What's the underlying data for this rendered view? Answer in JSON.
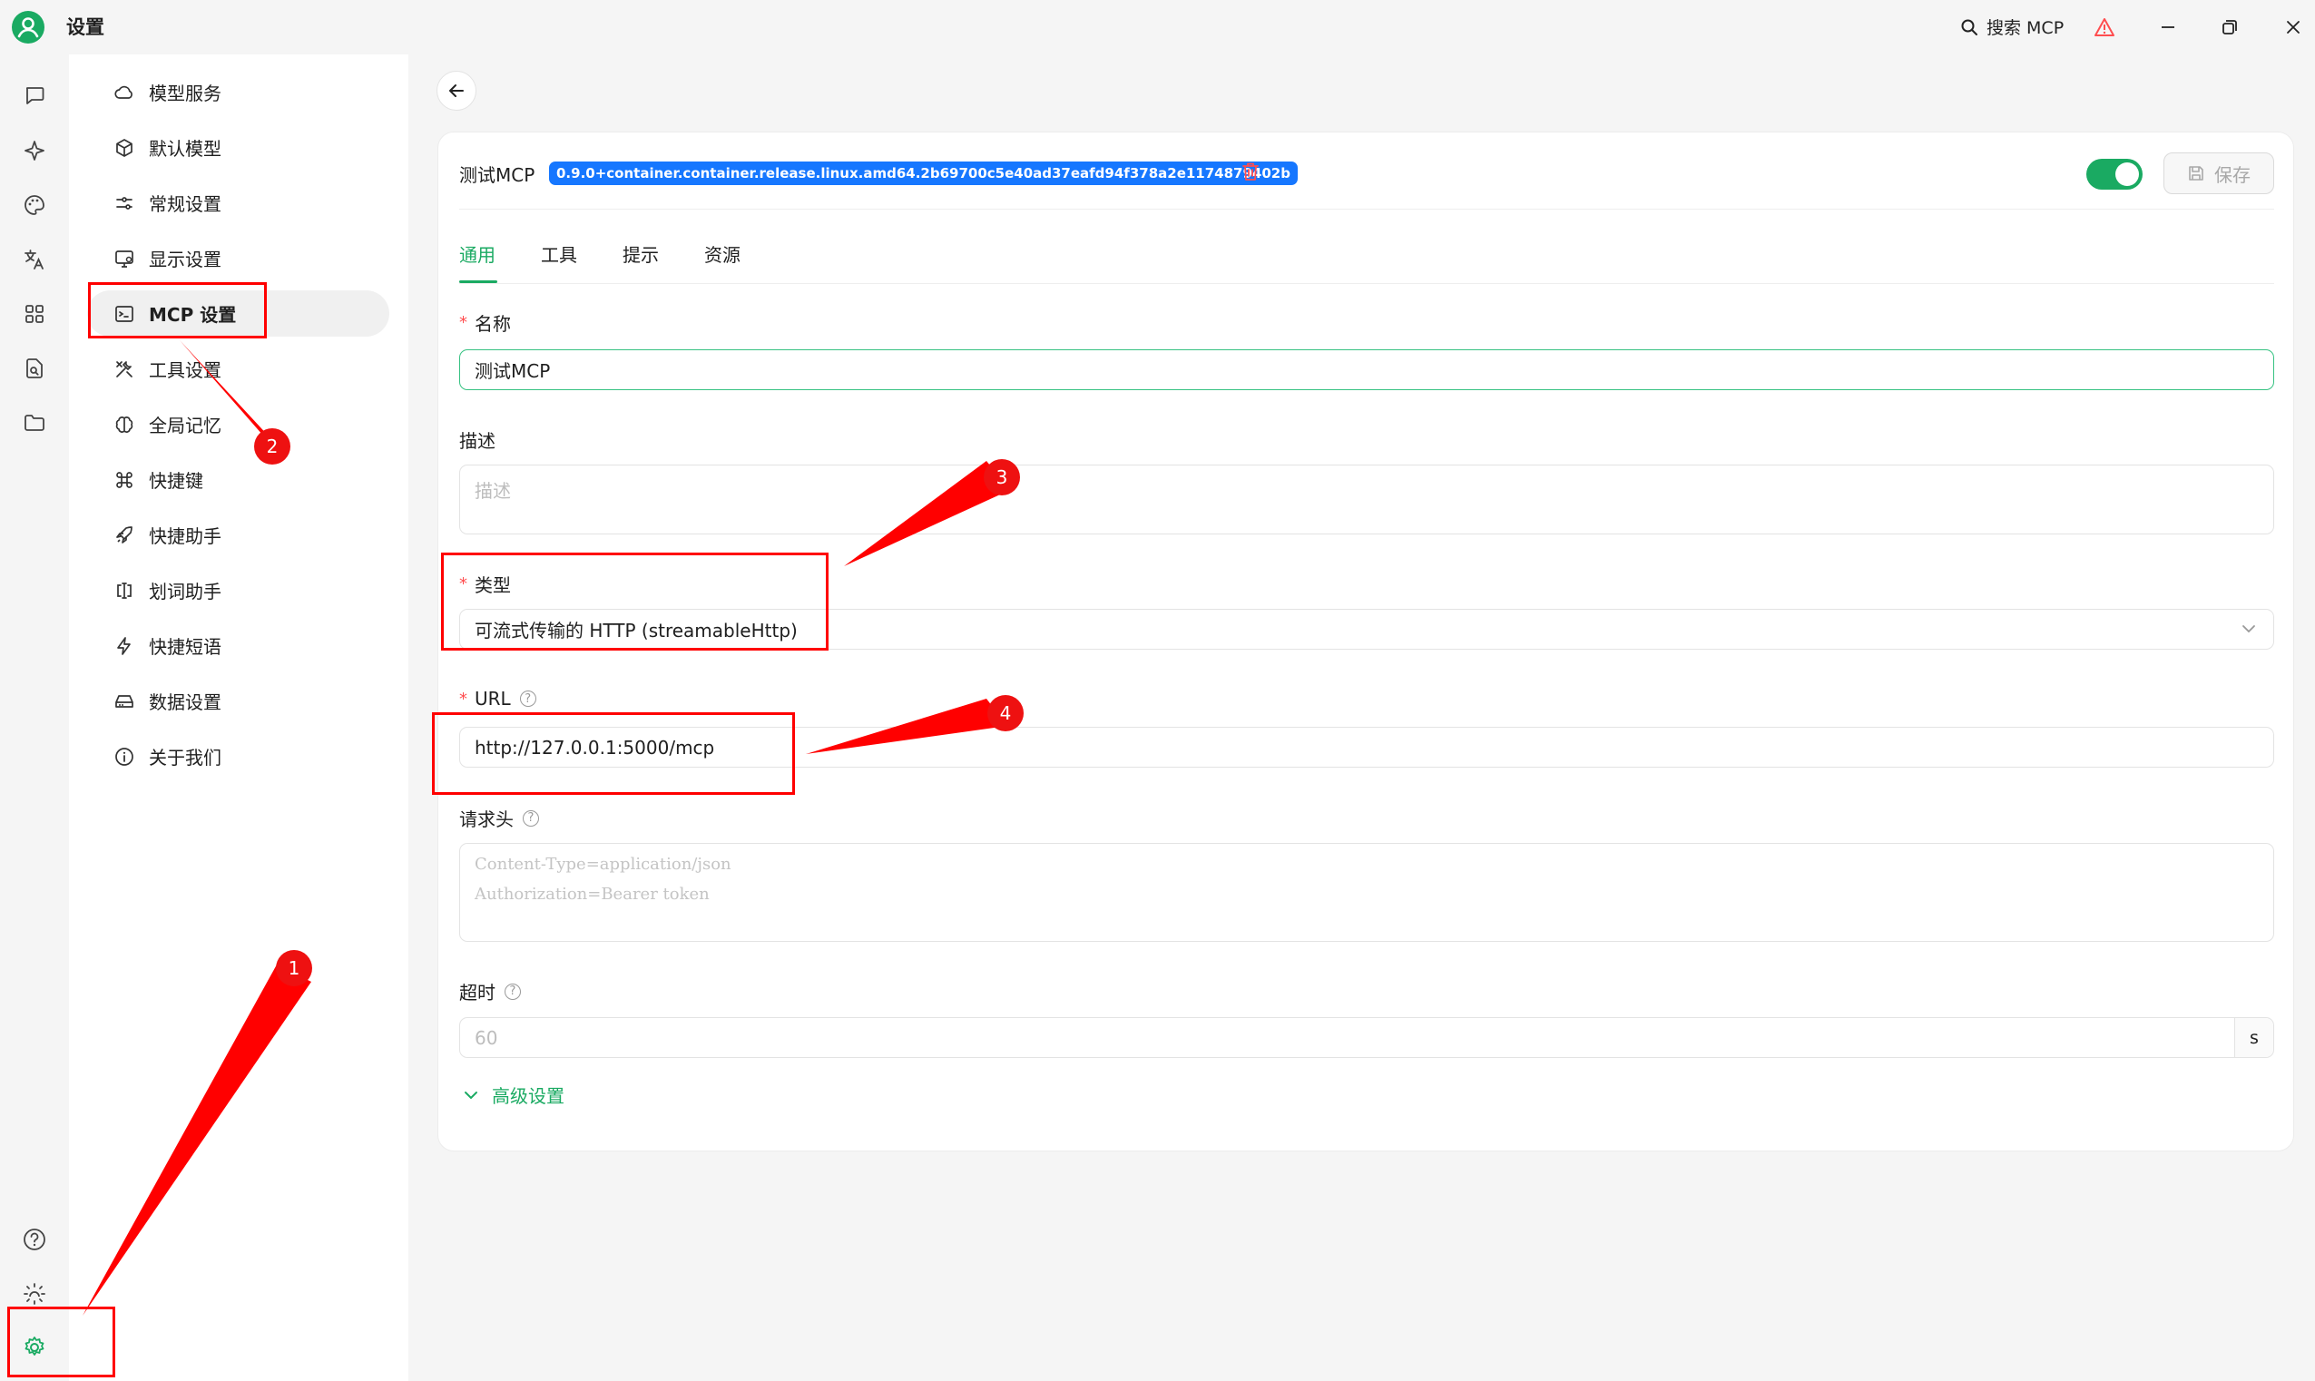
{
  "app": {
    "title": "设置",
    "search_label": "搜索 MCP"
  },
  "colors": {
    "accent": "#1aaa62",
    "tag": "#1677ff",
    "danger": "#ff4d4f",
    "annotation": "#ff0000"
  },
  "rail_icons": [
    "chat-icon",
    "sparkle-icon",
    "palette-icon",
    "translate-icon",
    "apps-grid-icon",
    "file-search-icon",
    "folder-icon",
    "help-icon",
    "theme-icon",
    "settings-gear-icon"
  ],
  "menu": {
    "items": [
      {
        "label": "模型服务",
        "icon": "cloud-icon"
      },
      {
        "label": "默认模型",
        "icon": "cube-icon"
      },
      {
        "label": "常规设置",
        "icon": "sliders-icon"
      },
      {
        "label": "显示设置",
        "icon": "monitor-icon"
      },
      {
        "label": "MCP 设置",
        "icon": "terminal-icon",
        "active": true
      },
      {
        "label": "工具设置",
        "icon": "tools-icon"
      },
      {
        "label": "全局记忆",
        "icon": "brain-icon"
      },
      {
        "label": "快捷键",
        "icon": "command-icon"
      },
      {
        "label": "快捷助手",
        "icon": "rocket-icon"
      },
      {
        "label": "划词助手",
        "icon": "text-select-icon"
      },
      {
        "label": "快捷短语",
        "icon": "zap-icon"
      },
      {
        "label": "数据设置",
        "icon": "hard-drive-icon"
      },
      {
        "label": "关于我们",
        "icon": "info-icon"
      }
    ]
  },
  "server": {
    "name": "测试MCP",
    "version": "0.9.0+container.container.release.linux.amd64.2b69700c5e40ad37eafd94f378a2e1174879402b",
    "enabled": true,
    "save_label": "保存"
  },
  "tabs": [
    "通用",
    "工具",
    "提示",
    "资源"
  ],
  "form": {
    "name": {
      "label": "名称",
      "value": "测试MCP"
    },
    "description": {
      "label": "描述",
      "placeholder": "描述"
    },
    "type": {
      "label": "类型",
      "value": "可流式传输的 HTTP (streamableHttp)"
    },
    "url": {
      "label": "URL",
      "value": "http://127.0.0.1:5000/mcp"
    },
    "headers": {
      "label": "请求头",
      "placeholder_lines": [
        "Content-Type=application/json",
        "Authorization=Bearer token"
      ]
    },
    "timeout": {
      "label": "超时",
      "placeholder": "60",
      "unit": "s"
    },
    "advanced_label": "高级设置"
  },
  "annotations": [
    "1",
    "2",
    "3",
    "4"
  ]
}
